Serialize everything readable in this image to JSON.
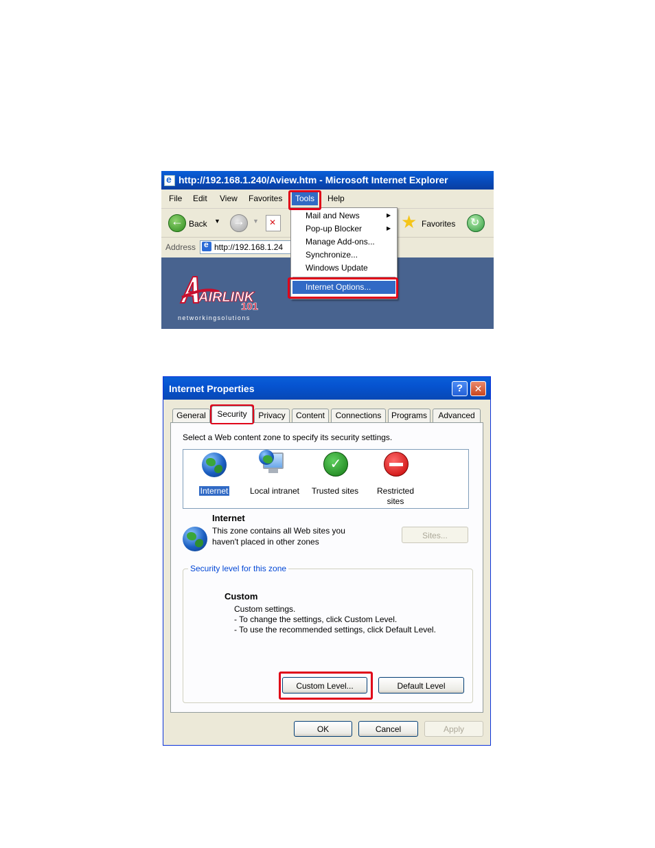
{
  "ie_window": {
    "title": "http://192.168.1.240/Aview.htm - Microsoft Internet Explorer",
    "menu": [
      "File",
      "Edit",
      "View",
      "Favorites",
      "Tools",
      "Help"
    ],
    "toolbar": {
      "back_label": "Back",
      "favorites_label": "Favorites"
    },
    "address": {
      "label": "Address",
      "value": "http://192.168.1.24"
    },
    "tools_menu": {
      "items": [
        "Mail and News",
        "Pop-up Blocker",
        "Manage Add-ons...",
        "Synchronize...",
        "Windows Update"
      ],
      "highlighted_item": "Internet Options..."
    },
    "logo": {
      "brand": "AIRLINK",
      "number": "101",
      "tagline": "networkingsolutions"
    }
  },
  "dialog": {
    "title": "Internet Properties",
    "tabs": [
      "General",
      "Security",
      "Privacy",
      "Content",
      "Connections",
      "Programs",
      "Advanced"
    ],
    "active_tab": "Security",
    "zone_prompt": "Select a Web content zone to specify its security settings.",
    "zones": [
      {
        "label": "Internet"
      },
      {
        "label": "Local intranet"
      },
      {
        "label": "Trusted sites"
      },
      {
        "label": "Restricted",
        "label2": "sites"
      }
    ],
    "selected_zone": {
      "name": "Internet",
      "desc_line1": "This zone contains all Web sites you",
      "desc_line2": "haven't placed in other zones",
      "sites_button": "Sites..."
    },
    "security_level": {
      "legend": "Security level for this zone",
      "heading": "Custom",
      "line1": "Custom settings.",
      "line2": "- To change the settings, click Custom Level.",
      "line3": "- To use the recommended settings, click Default Level.",
      "custom_button": "Custom Level...",
      "default_button": "Default Level"
    },
    "buttons": {
      "ok": "OK",
      "cancel": "Cancel",
      "apply": "Apply"
    }
  },
  "colors": {
    "highlight_red": "#e00018",
    "xp_blue": "#0a5fd8",
    "selection_blue": "#316ac5",
    "content_bg": "#48638f"
  }
}
